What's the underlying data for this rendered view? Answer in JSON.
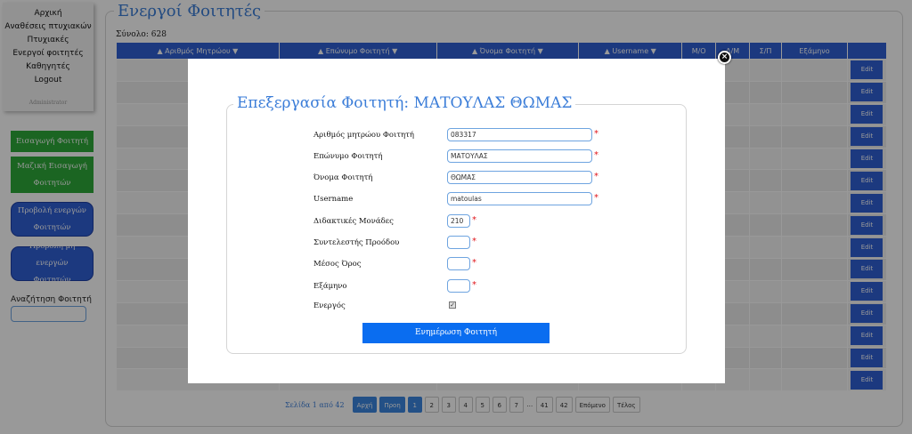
{
  "sidebar": {
    "nav": [
      "Αρχική",
      "Αναθέσεις πτυχιακών",
      "Πτυχιακές",
      "Ενεργοί φοιτητές",
      "Καθηγητές",
      "Logout"
    ],
    "admin_label": "Administrator",
    "buttons": [
      "Εισαγωγή Φοιτητή",
      "Μαζική Εισαγωγή Φοιτητών",
      "Προβολή ενεργών Φοιτητών",
      "Προβολή μη ενεργών Φοιτητών"
    ],
    "search_label": "Αναζήτηση Φοιτητή"
  },
  "main": {
    "title": "Ενεργοί Φοιτητές",
    "total": "Σύνολο: 628",
    "columns": [
      "▲ Αριθμός Μητρώου ▼",
      "▲ Επώνυμο Φοιτητή ▼",
      "▲ Όνομα Φοιτητή ▼",
      "▲ Username ▼",
      "Μ/Ο",
      "Δ/Μ",
      "Σ/Π",
      "Εξάμηνο",
      ""
    ],
    "edit_label": "Edit",
    "pager": {
      "label": "Σελίδα 1 από 42",
      "first": "Αρχή",
      "prev": "Προη",
      "pages": [
        "1",
        "2",
        "3",
        "4",
        "5",
        "6",
        "7"
      ],
      "ellipsis": "…",
      "tail_pages": [
        "41",
        "42"
      ],
      "next": "Επόμενο",
      "last": "Τέλος"
    }
  },
  "modal": {
    "title": "Επεξεργασία Φοιτητή: ΜΑΤΟΥΛΑΣ ΘΩΜΑΣ",
    "close": "×",
    "labels": {
      "am": "Αριθμός μητρώου Φοιτητή",
      "surname": "Επώνυμο Φοιτητή",
      "name": "Όνομα Φοιτητή",
      "username": "Username",
      "units": "Διδακτικές Μονάδες",
      "progress": "Συντελεστής Προόδου",
      "average": "Μέσος Όρος",
      "semester": "Εξάμηνο",
      "active": "Ενεργός"
    },
    "values": {
      "am": "083317",
      "surname": "ΜΑΤΟΥΛΑΣ",
      "name": "ΘΩΜΑΣ",
      "username": "matoulas",
      "units": "210",
      "progress": "",
      "average": "",
      "semester": ""
    },
    "active_checked": "✓",
    "required_mark": "*",
    "submit": "Ενημέρωση Φοιτητή"
  }
}
